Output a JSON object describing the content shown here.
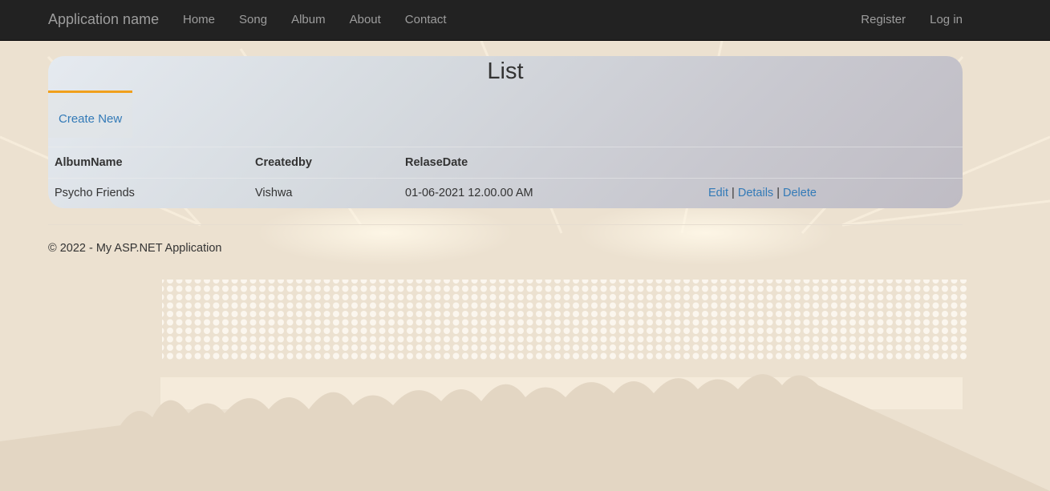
{
  "navbar": {
    "brand": "Application name",
    "left_links": [
      "Home",
      "Song",
      "Album",
      "About",
      "Contact"
    ],
    "right_links": [
      "Register",
      "Log in"
    ]
  },
  "main": {
    "title": "List",
    "create_new": "Create New",
    "table": {
      "headers": [
        "AlbumName",
        "Createdby",
        "RelaseDate"
      ],
      "rows": [
        {
          "album": "Psycho Friends",
          "created_by": "Vishwa",
          "release_date": "01-06-2021 12.00.00 AM"
        }
      ],
      "actions": {
        "edit": "Edit",
        "details": "Details",
        "delete": "Delete",
        "separator": "|"
      }
    }
  },
  "footer": {
    "text": "© 2022 - My ASP.NET Application"
  },
  "colors": {
    "navbar": "#222222",
    "link": "#337ab7",
    "accent": "#f0a01c"
  }
}
